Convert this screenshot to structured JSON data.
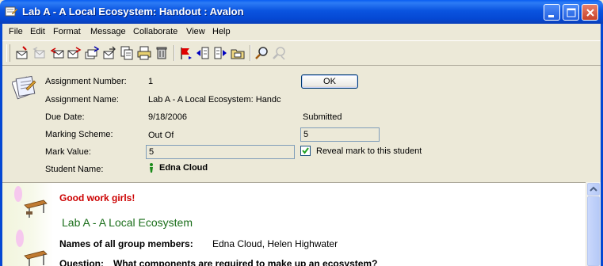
{
  "window": {
    "title": "Lab A - A Local Ecosystem: Handout : Avalon"
  },
  "menu": {
    "items": [
      "File",
      "Edit",
      "Format",
      "Message",
      "Collaborate",
      "View",
      "Help"
    ]
  },
  "toolbar": {
    "icons": [
      "new-message-icon",
      "reply-disabled-icon",
      "reply-all-icon",
      "forward-icon",
      "forward-group-icon",
      "send-icon",
      "copy-icon",
      "print-icon",
      "delete-icon",
      "flag-icon",
      "previous-icon",
      "next-icon",
      "folder-icon",
      "find-icon",
      "find-disabled-icon"
    ]
  },
  "assignment": {
    "number_label": "Assignment Number:",
    "number": "1",
    "name_label": "Assignment Name:",
    "name": "Lab A - A Local Ecosystem: Handc",
    "due_label": "Due Date:",
    "due": "9/18/2006",
    "status": "Submitted",
    "scheme_label": "Marking Scheme:",
    "scheme": "Out Of",
    "out_of": "5",
    "mark_label": "Mark Value:",
    "mark": "5",
    "reveal_label": "Reveal mark to this student",
    "reveal_checked": true,
    "student_label": "Student Name:",
    "student": "Edna Cloud",
    "ok_label": "OK"
  },
  "content": {
    "comment": "Good work girls!",
    "heading": "Lab A - A Local Ecosystem",
    "members_label": "Names of all group members:",
    "members": "Edna Cloud, Helen Highwater",
    "question_label": "Question:",
    "question": "What components are required to make up an ecosystem?"
  },
  "colors": {
    "titlebar": "#0a54e0",
    "comment": "#cc0000",
    "heading": "#1a6e1a"
  }
}
